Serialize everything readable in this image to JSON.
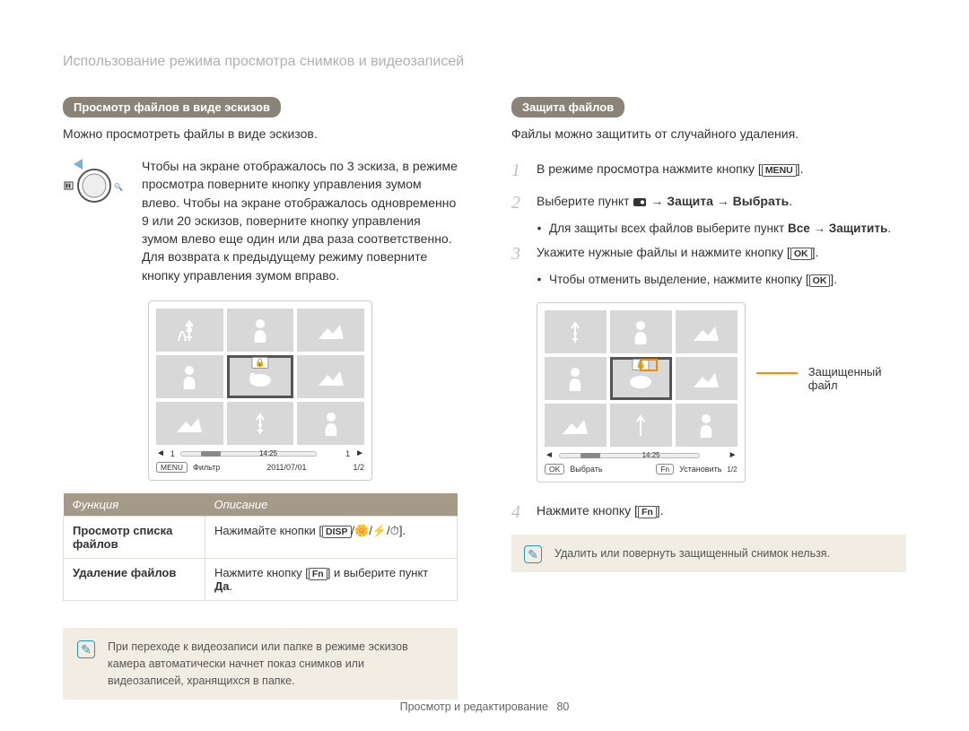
{
  "page_title": "Использование режима просмотра снимков и видеозаписей",
  "left": {
    "header": "Просмотр файлов в виде эскизов",
    "desc": "Можно просмотреть файлы в виде эскизов.",
    "zoom_text": "Чтобы на экране отображалось по 3 эскиза, в режиме просмотра поверните кнопку управления зумом влево. Чтобы на экране отображалось одновременно 9 или 20 эскизов, поверните кнопку управления зумом влево еще один или два раза соответственно. Для возврата к предыдущему режиму поверните кнопку управления зумом вправо.",
    "screen": {
      "menu_tag": "MENU",
      "filter": "Фильтр",
      "date": "2011/07/01",
      "count": "1/2",
      "bar_left": "1",
      "bar_time": "14:25",
      "bar_right": "1"
    },
    "table": {
      "col1": "Функция",
      "col2": "Описание",
      "row1_label": "Просмотр списка файлов",
      "row1_desc_pre": "Нажимайте кнопки [",
      "row1_desc_key": "DISP",
      "row1_desc_post": "/🌼/⚡/⏱].",
      "row2_label": "Удаление файлов",
      "row2_desc_pre": "Нажмите кнопку [",
      "row2_desc_key": "Fn",
      "row2_desc_mid": "] и выберите пункт ",
      "row2_desc_bold": "Да",
      "row2_desc_post": "."
    },
    "note": "При переходе к видеозаписи или папке в режиме эскизов камера автоматически начнет показ снимков или видеозаписей, хранящихся в папке."
  },
  "right": {
    "header": "Защита файлов",
    "desc": "Файлы можно защитить от случайного удаления.",
    "step1_pre": "В режиме просмотра нажмите кнопку [",
    "step1_key": "MENU",
    "step1_post": "].",
    "step2_pre": "Выберите пункт ",
    "step2_arrow": " → ",
    "step2_b1": "Защита",
    "step2_b2": "Выбрать",
    "step2_post": ".",
    "step2_sub_pre": "Для защиты всех файлов выберите пункт ",
    "step2_sub_b1": "Все",
    "step2_sub_b2": "Защитить",
    "step2_sub_post": ".",
    "step3_pre": "Укажите нужные файлы и нажмите кнопку [",
    "step3_key": "OK",
    "step3_post": "].",
    "step3_sub_pre": "Чтобы отменить выделение, нажмите кнопку [",
    "step3_sub_key": "OK",
    "step3_sub_post": "].",
    "protected_label": "Защищенный файл",
    "screen": {
      "ok_tag": "OK",
      "select": "Выбрать",
      "fn_tag": "Fn",
      "set": "Установить",
      "set_num": "1/2",
      "bar_time": "14:25"
    },
    "step4_pre": "Нажмите кнопку [",
    "step4_key": "Fn",
    "step4_post": "].",
    "small_note": "Удалить или повернуть защищенный снимок нельзя."
  },
  "footer": {
    "section": "Просмотр и редактирование",
    "page_num": "80"
  }
}
